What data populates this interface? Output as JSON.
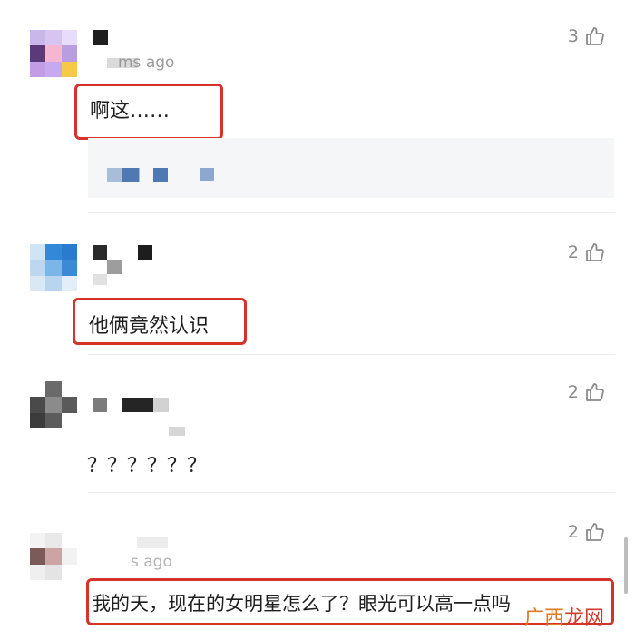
{
  "comments": [
    {
      "time": "ms ago",
      "likes": "3",
      "text": "啊这……"
    },
    {
      "likes": "2",
      "text": "他俩竟然认识"
    },
    {
      "likes": "2",
      "text": "？？？？？？"
    },
    {
      "time": "s ago",
      "likes": "2",
      "text": "我的天，现在的女明星怎么了？眼光可以高一点吗"
    }
  ],
  "watermark": {
    "part1": "广西",
    "part2": "龙网"
  },
  "colors": {
    "highlight": "#d6322c",
    "like": "#8a8a8a",
    "reply_bg": "#f5f6f8"
  }
}
